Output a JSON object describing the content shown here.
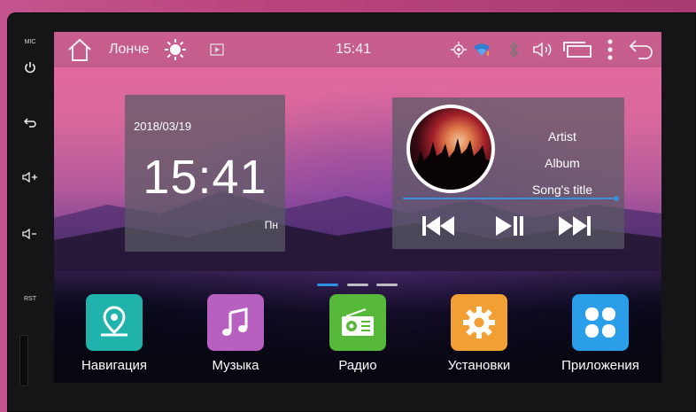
{
  "hardware": {
    "mic_label": "MIC",
    "rst_label": "RST"
  },
  "statusbar": {
    "app_name": "Лонче",
    "time": "15:41"
  },
  "clock_widget": {
    "date": "2018/03/19",
    "time": "15:41",
    "day": "Пн"
  },
  "music_widget": {
    "artist": "Artist",
    "album": "Album",
    "song_title": "Song's title",
    "accent_color": "#3d8fd8"
  },
  "page_indicator": {
    "count": 3,
    "active_index": 0
  },
  "apps": [
    {
      "label": "Навигация",
      "icon": "map-pin-icon",
      "color": "#1fb3ac"
    },
    {
      "label": "Музыка",
      "icon": "music-note-icon",
      "color": "#b760c0"
    },
    {
      "label": "Радио",
      "icon": "radio-icon",
      "color": "#56b93a"
    },
    {
      "label": "Установки",
      "icon": "gear-icon",
      "color": "#f2a033"
    },
    {
      "label": "Приложения",
      "icon": "apps-grid-icon",
      "color": "#2a9ee8"
    }
  ]
}
